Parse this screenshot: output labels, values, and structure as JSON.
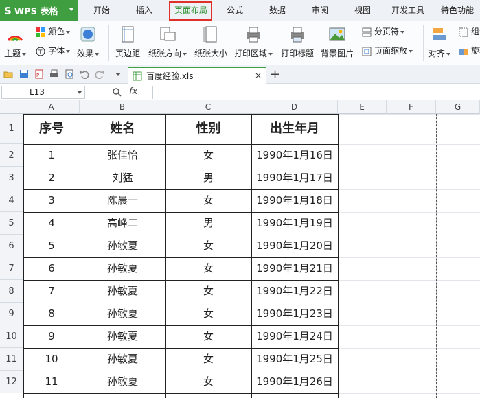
{
  "app": {
    "name": "WPS 表格",
    "logo": "S"
  },
  "tabs": [
    "开始",
    "插入",
    "页面布局",
    "公式",
    "数据",
    "审阅",
    "视图",
    "开发工具",
    "特色功能"
  ],
  "active_tab_index": 2,
  "ribbon": {
    "theme": "主题",
    "colors": "颜色",
    "fonts": "字体",
    "effects": "效果",
    "margins": "页边距",
    "orientation": "纸张方向",
    "size": "纸张大小",
    "print_area": "打印区域",
    "print_titles": "打印标题",
    "background": "背景图片",
    "breaks": "分页符",
    "scale": "页面缩放",
    "align": "对齐",
    "group": "组合",
    "rotate": "旋转"
  },
  "document": {
    "tab_name": "百度经验.xls",
    "close": "×",
    "add": "+"
  },
  "formula": {
    "cell_ref": "L13",
    "fx": "fx"
  },
  "columns": [
    "A",
    "B",
    "C",
    "D",
    "E",
    "F",
    "G"
  ],
  "table": {
    "headers": [
      "序号",
      "姓名",
      "性别",
      "出生年月"
    ],
    "rows": [
      [
        "1",
        "张佳怡",
        "女",
        "1990年1月16日"
      ],
      [
        "2",
        "刘猛",
        "男",
        "1990年1月17日"
      ],
      [
        "3",
        "陈晨一",
        "女",
        "1990年1月18日"
      ],
      [
        "4",
        "高峰二",
        "男",
        "1990年1月19日"
      ],
      [
        "5",
        "孙敏夏",
        "女",
        "1990年1月20日"
      ],
      [
        "6",
        "孙敏夏",
        "女",
        "1990年1月21日"
      ],
      [
        "7",
        "孙敏夏",
        "女",
        "1990年1月22日"
      ],
      [
        "8",
        "孙敏夏",
        "女",
        "1990年1月23日"
      ],
      [
        "9",
        "孙敏夏",
        "女",
        "1990年1月24日"
      ],
      [
        "10",
        "孙敏夏",
        "女",
        "1990年1月25日"
      ],
      [
        "11",
        "孙敏夏",
        "女",
        "1990年1月26日"
      ]
    ]
  },
  "row_numbers": [
    "1",
    "2",
    "3",
    "4",
    "5",
    "6",
    "7",
    "8",
    "9",
    "10",
    "11",
    "12"
  ],
  "colors": {
    "accent": "#3f9e3f",
    "highlight": "#e0302a"
  }
}
